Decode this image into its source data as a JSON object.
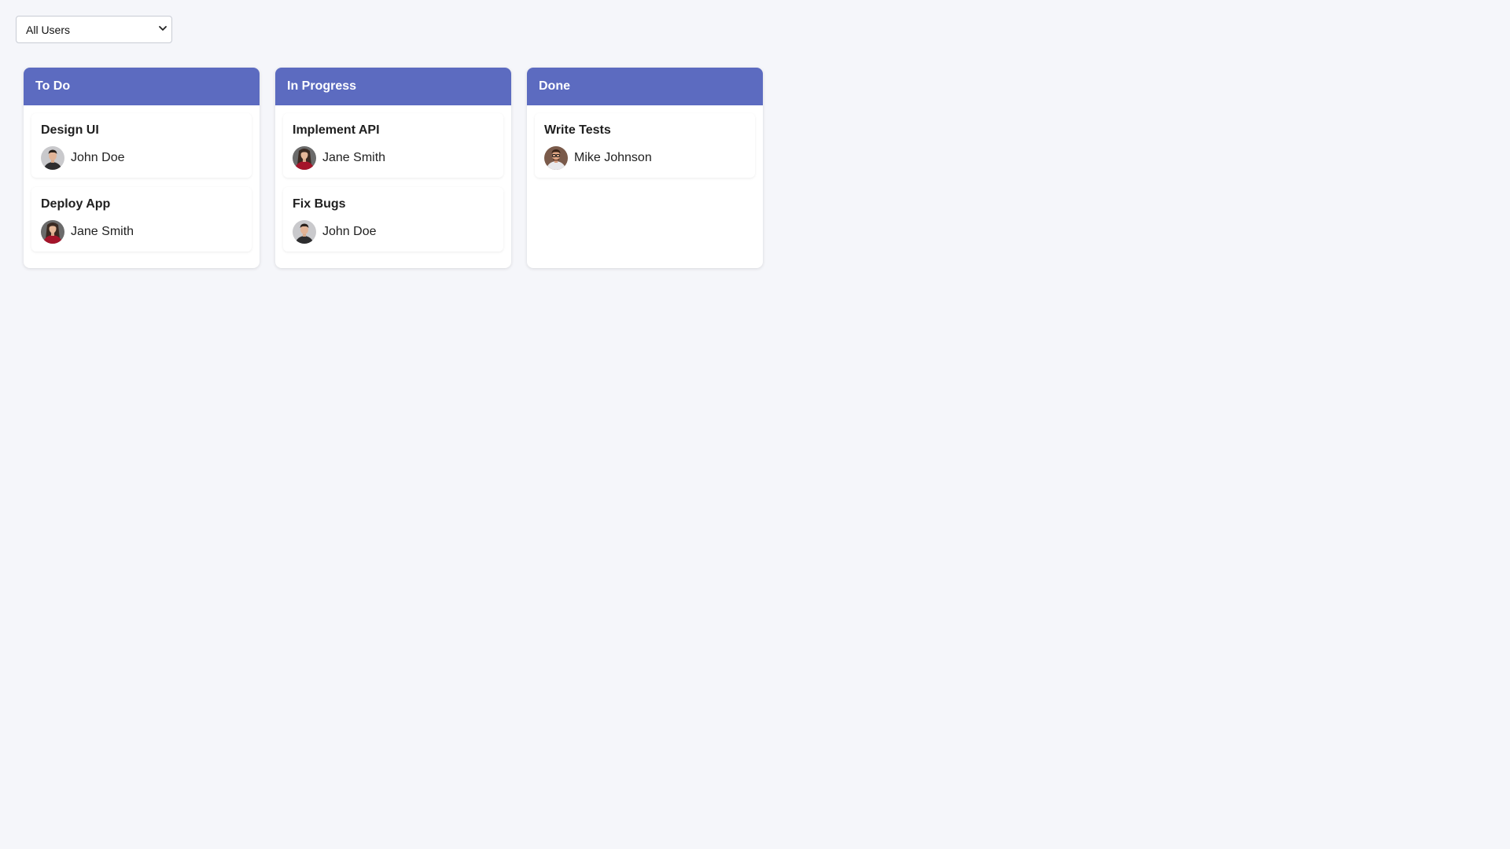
{
  "filter": {
    "selected": "All Users",
    "options": [
      "All Users"
    ]
  },
  "columns": [
    {
      "title": "To Do",
      "cards": [
        {
          "title": "Design UI",
          "assignee": "John Doe",
          "avatar": "john-doe-avatar"
        },
        {
          "title": "Deploy App",
          "assignee": "Jane Smith",
          "avatar": "jane-smith-avatar"
        }
      ]
    },
    {
      "title": "In Progress",
      "cards": [
        {
          "title": "Implement API",
          "assignee": "Jane Smith",
          "avatar": "jane-smith-avatar"
        },
        {
          "title": "Fix Bugs",
          "assignee": "John Doe",
          "avatar": "john-doe-avatar"
        }
      ]
    },
    {
      "title": "Done",
      "cards": [
        {
          "title": "Write Tests",
          "assignee": "Mike Johnson",
          "avatar": "mike-johnson-avatar"
        }
      ]
    }
  ],
  "colors": {
    "header": "#5c6bc0",
    "background": "#f5f6fa",
    "card": "#ffffff"
  }
}
